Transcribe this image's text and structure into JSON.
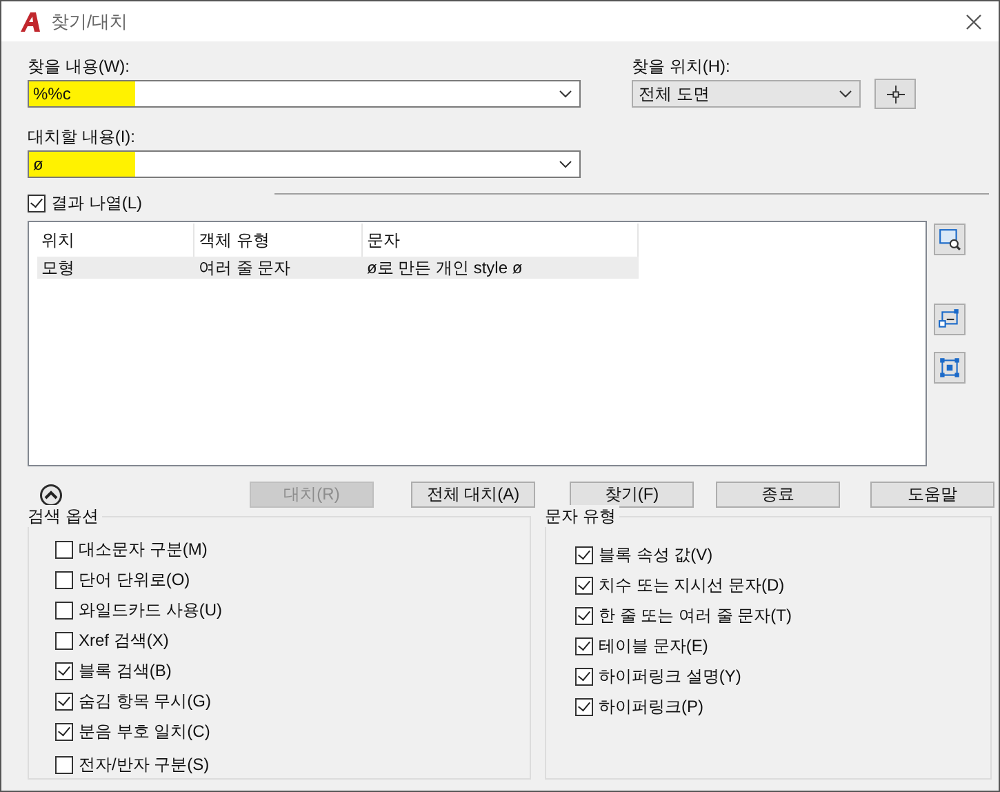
{
  "window": {
    "title": "찾기/대치"
  },
  "find_what": {
    "label": "찾을 내용(W):",
    "value": "%%c",
    "highlighted": true
  },
  "replace_with": {
    "label": "대치할 내용(I):",
    "value": "ø",
    "highlighted": true
  },
  "find_where": {
    "label": "찾을 위치(H):",
    "value": "전체 도면"
  },
  "list_results": {
    "label": "결과 나열(L)",
    "checked": true
  },
  "results": {
    "columns": [
      "위치",
      "객체 유형",
      "문자"
    ],
    "rows": [
      {
        "cells": [
          "모형",
          "여러 줄 문자",
          "ø로 만든 개인 style ø"
        ],
        "selected": true
      }
    ]
  },
  "buttons": [
    {
      "label": "대치(R)",
      "disabled": true
    },
    {
      "label": "전체 대치(A)",
      "disabled": false
    },
    {
      "label": "찾기(F)",
      "disabled": false
    },
    {
      "label": "종료",
      "disabled": false
    },
    {
      "label": "도움말",
      "disabled": false
    }
  ],
  "search_options": {
    "title": "검색 옵션",
    "items": [
      {
        "label": "대소문자 구분(M)",
        "checked": false
      },
      {
        "label": "단어 단위로(O)",
        "checked": false
      },
      {
        "label": "와일드카드 사용(U)",
        "checked": false
      },
      {
        "label": "Xref 검색(X)",
        "checked": false
      },
      {
        "label": "블록 검색(B)",
        "checked": true
      },
      {
        "label": "숨김 항목 무시(G)",
        "checked": true
      },
      {
        "label": "분음 부호 일치(C)",
        "checked": true
      },
      {
        "label": "전자/반자 구분(S)",
        "checked": false
      }
    ]
  },
  "text_types": {
    "title": "문자 유형",
    "items": [
      {
        "label": "블록 속성 값(V)",
        "checked": true
      },
      {
        "label": "치수 또는 지시선 문자(D)",
        "checked": true
      },
      {
        "label": "한 줄 또는 여러 줄 문자(T)",
        "checked": true
      },
      {
        "label": "테이블 문자(E)",
        "checked": true
      },
      {
        "label": "하이퍼링크 설명(Y)",
        "checked": true
      },
      {
        "label": "하이퍼링크(P)",
        "checked": true
      }
    ]
  }
}
